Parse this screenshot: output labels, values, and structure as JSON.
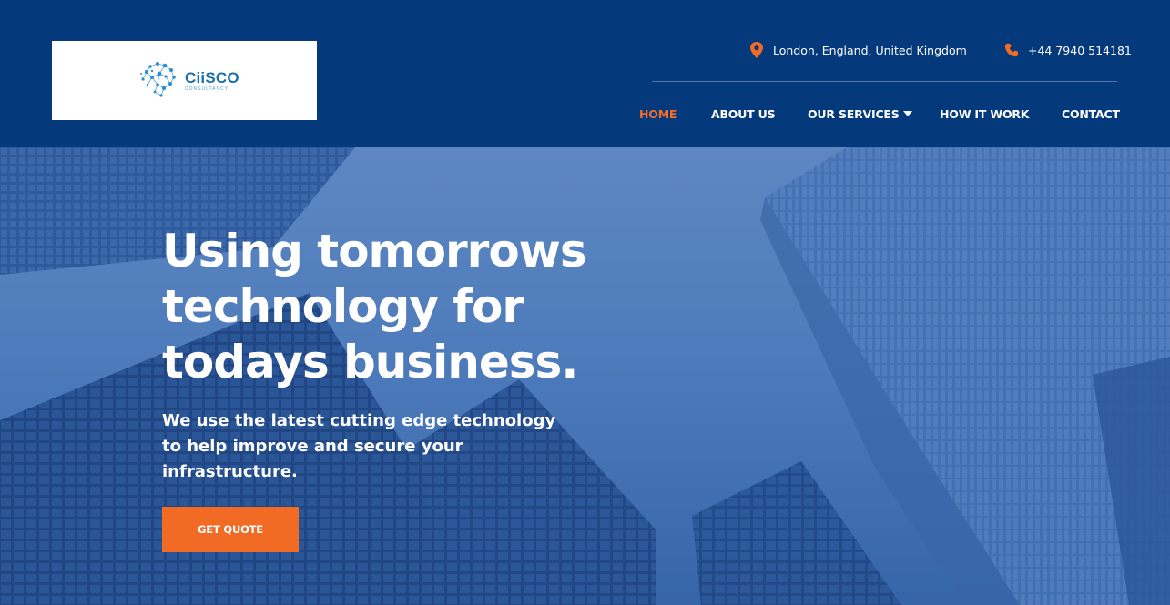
{
  "brand": {
    "logo_text": "CiiSCO",
    "logo_subtext": "CONSULTANCY",
    "accent_color": "#f26b25",
    "header_color": "#043a7c"
  },
  "contact": {
    "location_icon": "map-pin-icon",
    "location": "London, England, United Kingdom",
    "phone_icon": "phone-icon",
    "phone": "+44 7940 514181"
  },
  "nav": {
    "items": [
      {
        "label": "HOME",
        "active": true
      },
      {
        "label": "ABOUT US",
        "active": false
      },
      {
        "label": "OUR SERVICES",
        "active": false,
        "has_dropdown": true,
        "dropdown_icon": "caret-down-icon"
      },
      {
        "label": "HOW IT WORK",
        "active": false
      },
      {
        "label": "CONTACT",
        "active": false
      }
    ]
  },
  "hero": {
    "headline_lines": [
      "Using tomorrows",
      "technology for",
      "todays business."
    ],
    "subline_lines": [
      "We use the latest cutting edge technology",
      "to help improve and secure your",
      "infrastructure."
    ],
    "cta_label": "GET QUOTE"
  }
}
